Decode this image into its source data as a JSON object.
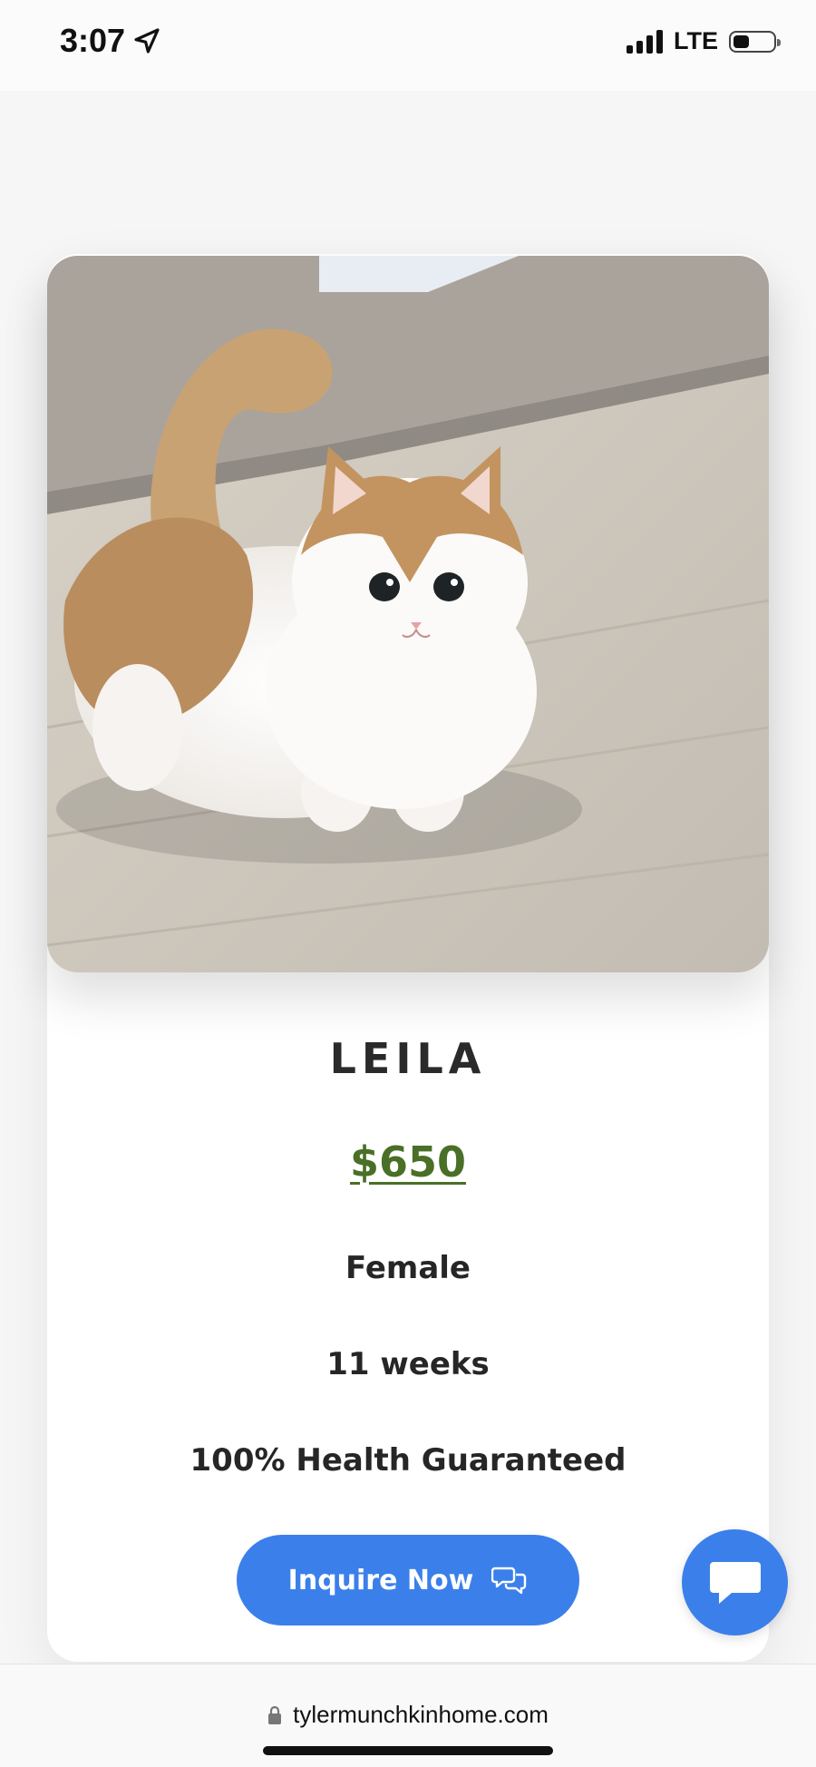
{
  "status_bar": {
    "time": "3:07",
    "network": "LTE",
    "icons": [
      "location-arrow-icon",
      "signal-icon",
      "battery-icon"
    ]
  },
  "listing": {
    "name": "LEILA",
    "price": "$650",
    "sex": "Female",
    "age": "11 weeks",
    "guarantee": "100% Health Guaranteed",
    "inquire_label": "Inquire Now",
    "photo_icon": "kitten-photo"
  },
  "chat_widget": {
    "icon": "chat-bubble-icon"
  },
  "browser": {
    "url": "tylermunchkinhome.com"
  },
  "colors": {
    "accent_blue": "#3b80ea",
    "price_green": "#4a6f27",
    "text": "#262626"
  }
}
